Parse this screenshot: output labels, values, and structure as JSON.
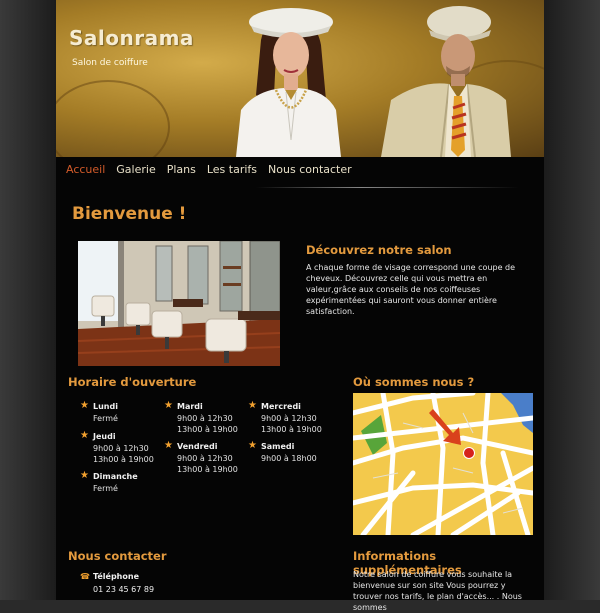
{
  "site": {
    "title": "Salonrama",
    "subtitle": "Salon de coiffure"
  },
  "nav": [
    {
      "label": "Accueil",
      "active": true
    },
    {
      "label": "Galerie"
    },
    {
      "label": "Plans"
    },
    {
      "label": "Les tarifs"
    },
    {
      "label": "Nous contacter"
    }
  ],
  "welcome": "Bienvenue !",
  "discover": {
    "title": "Découvrez notre salon",
    "text": "A chaque forme de visage correspond une coupe de cheveux. Découvrez celle qui vous mettra en valeur,grâce aux conseils de nos coiffeuses expérimentées qui sauront vous donner entière satisfaction."
  },
  "hours": {
    "title": "Horaire d'ouverture",
    "days": [
      {
        "day": "Lundi",
        "times": [
          "Fermé"
        ]
      },
      {
        "day": "Mardi",
        "times": [
          "9h00 à 12h30",
          "13h00 à 19h00"
        ]
      },
      {
        "day": "Mercredi",
        "times": [
          "9h00 à 12h30",
          "13h00 à 19h00"
        ]
      },
      {
        "day": "Jeudi",
        "times": [
          "9h00 à 12h30",
          "13h00 à 19h00"
        ]
      },
      {
        "day": "Vendredi",
        "times": [
          "9h00 à 12h30",
          "13h00 à 19h00"
        ]
      },
      {
        "day": "Samedi",
        "times": [
          "9h00 à 18h00"
        ]
      },
      {
        "day": "Dimanche",
        "times": [
          "Fermé"
        ]
      }
    ]
  },
  "where": {
    "title": "Où sommes nous ?"
  },
  "contact": {
    "title": "Nous contacter",
    "phone_label": "Téléphone",
    "phone": "01 23 45 67 89"
  },
  "info": {
    "title": "Informations supplémentaires",
    "text": "Notre salon de coiffure vous souhaite la bienvenue sur son site Vous pourrez y trouver nos tarifs, le plan d'accès... . Nous sommes"
  },
  "colors": {
    "accent": "#e39a3e",
    "active_nav": "#d35b2a",
    "star": "#f2a12f"
  }
}
